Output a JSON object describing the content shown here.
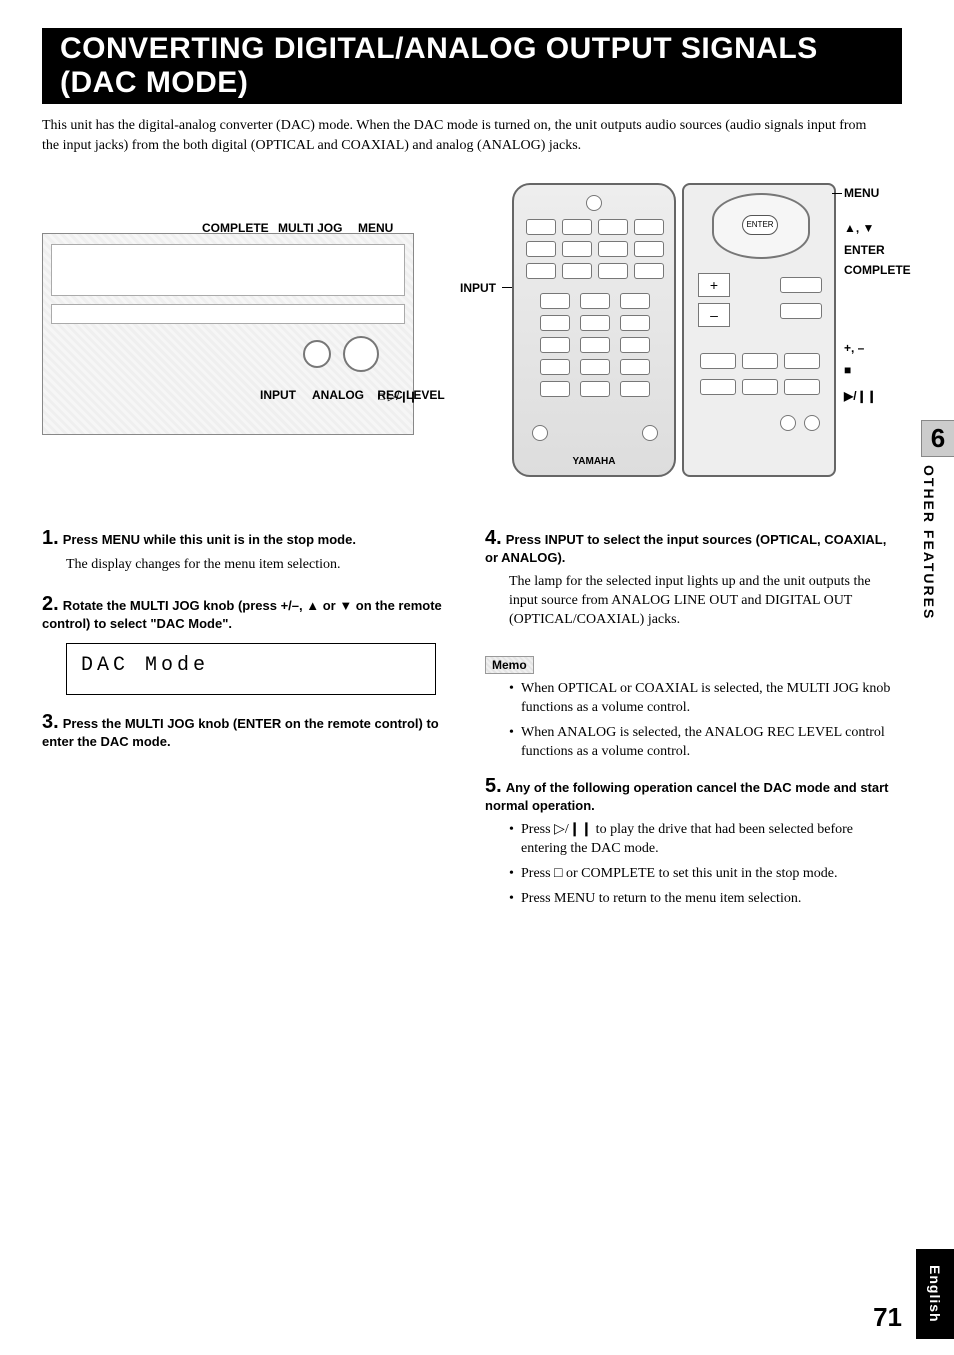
{
  "title": "CONVERTING DIGITAL/ANALOG OUTPUT SIGNALS (DAC MODE)",
  "intro": "This unit has the digital-analog converter (DAC) mode. When the DAC mode is turned on, the unit outputs audio sources (audio signals input from the input jacks) from the both digital (OPTICAL and COAXIAL) and analog (ANALOG) jacks.",
  "panel": {
    "top_complete": "COMPLETE",
    "top_multijog": "MULTI JOG",
    "top_menu": "MENU",
    "bottom_input": "INPUT",
    "bottom_analog": "ANALOG    REC LEVEL",
    "bottom_stop": "□  ▷/❙❙"
  },
  "remote": {
    "input": "INPUT",
    "menu": "MENU",
    "ud": "▲, ▼",
    "enter": "ENTER",
    "complete": "COMPLETE",
    "pm": "+, –",
    "stop": "■",
    "play": "▶/❙❙",
    "brand": "YAMAHA"
  },
  "steps": {
    "s1": {
      "num": "1.",
      "bold": "Press MENU while this unit is in the stop mode.",
      "body": "The display changes for the menu item selection."
    },
    "s2": {
      "num": "2.",
      "bold": "Rotate the MULTI JOG knob (press +/–, ▲ or ▼ on the remote control) to select \"DAC Mode\"."
    },
    "lcd": {
      "main": "DAC  Mode",
      "sub": ""
    },
    "s3": {
      "num": "3.",
      "bold": "Press the MULTI JOG knob (ENTER on the remote control) to enter the DAC mode."
    },
    "s4": {
      "num": "4.",
      "bold": "Press INPUT to select the input sources (OPTICAL, COAXIAL, or ANALOG).",
      "body": "The lamp for the selected input lights up and the unit outputs the input source from ANALOG LINE OUT and DIGITAL OUT (OPTICAL/COAXIAL) jacks."
    },
    "memo_h": "Memo",
    "memo": [
      "When OPTICAL or COAXIAL is selected, the MULTI JOG knob functions as a volume control.",
      "When ANALOG is selected, the ANALOG REC LEVEL control functions as a volume control."
    ],
    "s5": {
      "num": "5.",
      "bold": "Any of the following operation cancel the DAC mode and start normal operation."
    },
    "s5list": [
      "Press ▷/❙❙ to play the drive that had been selected before entering the DAC mode.",
      "Press □ or COMPLETE to set this unit in the stop mode.",
      "Press MENU to return to the menu item selection."
    ]
  },
  "side": {
    "num": "6",
    "label": "OTHER FEATURES"
  },
  "page_no": "71",
  "lang_tab": "English"
}
